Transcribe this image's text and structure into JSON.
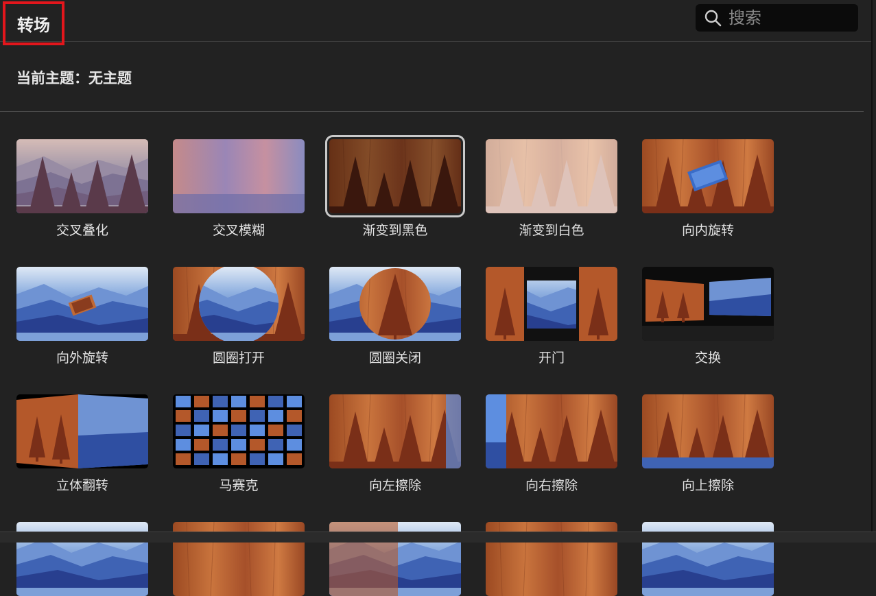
{
  "header": {
    "title": "转场"
  },
  "search": {
    "placeholder": "搜索",
    "icon": "search-icon"
  },
  "theme_line": "当前主题：无主题",
  "colors": {
    "background": "#222222",
    "highlight_border": "#e3161c",
    "wood": "#b4582a",
    "tree": "#6a2d1a",
    "sky": "#a9c3e6",
    "mountain": "#3a5aa8"
  },
  "transitions": [
    {
      "label": "交叉叠化",
      "style": "dissolve",
      "selected": false
    },
    {
      "label": "交叉模糊",
      "style": "blur",
      "selected": false
    },
    {
      "label": "渐变到黑色",
      "style": "black",
      "selected": true
    },
    {
      "label": "渐变到白色",
      "style": "white",
      "selected": false
    },
    {
      "label": "向内旋转",
      "style": "spinin",
      "selected": false
    },
    {
      "label": "向外旋转",
      "style": "spinout",
      "selected": false
    },
    {
      "label": "圆圈打开",
      "style": "circleopen",
      "selected": false
    },
    {
      "label": "圆圈关闭",
      "style": "circleclose",
      "selected": false
    },
    {
      "label": "开门",
      "style": "doors",
      "selected": false
    },
    {
      "label": "交换",
      "style": "swap",
      "selected": false
    },
    {
      "label": "立体翻转",
      "style": "cube",
      "selected": false
    },
    {
      "label": "马赛克",
      "style": "mosaic",
      "selected": false
    },
    {
      "label": "向左擦除",
      "style": "wipeleft",
      "selected": false
    },
    {
      "label": "向右擦除",
      "style": "wiperight",
      "selected": false
    },
    {
      "label": "向上擦除",
      "style": "wipeup",
      "selected": false
    },
    {
      "label": "",
      "style": "partial-mountain",
      "selected": false
    },
    {
      "label": "",
      "style": "partial-wood",
      "selected": false
    },
    {
      "label": "",
      "style": "partial-mix",
      "selected": false
    },
    {
      "label": "",
      "style": "partial-wood2",
      "selected": false
    },
    {
      "label": "",
      "style": "partial-mountain2",
      "selected": false
    }
  ]
}
